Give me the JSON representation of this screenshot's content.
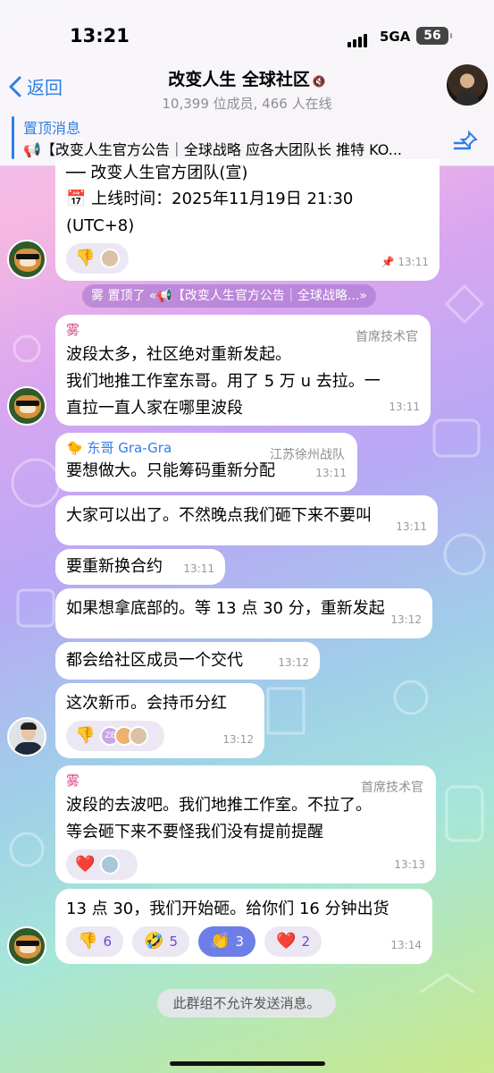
{
  "status": {
    "time": "13:21",
    "network": "5GA",
    "battery": "56"
  },
  "header": {
    "back_label": "返回",
    "title": "改变人生 全球社区",
    "mute_icon": "🔇",
    "subtitle": "10,399 位成员, 466 人在线"
  },
  "pinned": {
    "label": "置顶消息",
    "text": "📢【改变人生官方公告｜全球战略 应各大团队长 推特 KO..."
  },
  "messages": {
    "m1": {
      "line1": "── 改变人生官方团队(宣)",
      "line2": "📅 上线时间：2025年11月19日 21:30",
      "line3": "(UTC+8)",
      "time": "13:11",
      "react1": "👎"
    },
    "system_pin": "雾 置顶了 «📢【改变人生官方公告｜全球战略...»",
    "m2": {
      "sender": "雾",
      "rank": "首席技术官",
      "line1": "波段太多，社区绝对重新发起。",
      "line2": "我们地推工作室东哥。用了 5 万 u 去拉。一",
      "line3": "直拉一直人家在哪里波段",
      "time": "13:11"
    },
    "m3": {
      "sender": "🐤 东哥 Gra-Gra",
      "rank": "江苏徐州战队",
      "text": "要想做大。只能筹码重新分配",
      "time": "13:11"
    },
    "m4": {
      "text": "大家可以出了。不然晚点我们砸下来不要叫",
      "time": "13:11"
    },
    "m5": {
      "text": "要重新换合约",
      "time": "13:11"
    },
    "m6": {
      "text": "如果想拿底部的。等 13 点 30 分，重新发起",
      "time": "13:12"
    },
    "m7": {
      "text": "都会给社区成员一个交代",
      "time": "13:12"
    },
    "m8": {
      "text": "这次新币。会持币分红",
      "time": "13:12",
      "react1": "👎",
      "badge": "ZE"
    },
    "m9": {
      "sender": "雾",
      "rank": "首席技术官",
      "line1": "波段的去波吧。我们地推工作室。不拉了。",
      "line2": "等会砸下来不要怪我们没有提前提醒",
      "time": "13:13",
      "react1": "❤️"
    },
    "m10": {
      "text": "13 点 30，我们开始砸。给你们 16 分钟出货",
      "time": "13:14",
      "reactions": [
        {
          "emoji": "👎",
          "count": "6"
        },
        {
          "emoji": "🤣",
          "count": "5"
        },
        {
          "emoji": "👏",
          "count": "3"
        },
        {
          "emoji": "❤️",
          "count": "2"
        }
      ]
    }
  },
  "footer_notice": "此群组不允许发送消息。",
  "colors": {
    "accent": "#2f7ee6",
    "sender_name": "#d44a8a",
    "selected_reaction": "#6d7fe6"
  }
}
